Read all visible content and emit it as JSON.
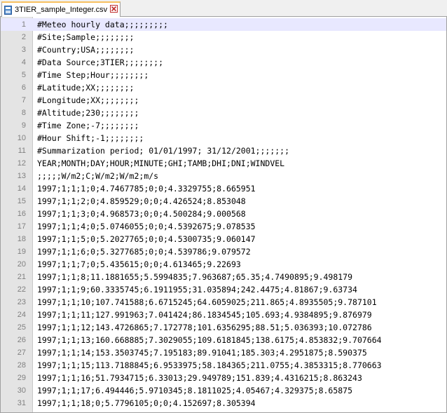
{
  "tab": {
    "label": "3TIER_sample_Integer.csv",
    "icon": "file-icon",
    "close_icon": "close-icon",
    "accent": "#f7c060"
  },
  "lines": [
    {
      "n": "1",
      "text": "#Meteo hourly data;;;;;;;;;"
    },
    {
      "n": "2",
      "text": "#Site;Sample;;;;;;;;"
    },
    {
      "n": "3",
      "text": "#Country;USA;;;;;;;;"
    },
    {
      "n": "4",
      "text": "#Data Source;3TIER;;;;;;;;"
    },
    {
      "n": "5",
      "text": "#Time Step;Hour;;;;;;;;"
    },
    {
      "n": "6",
      "text": "#Latitude;XX;;;;;;;;"
    },
    {
      "n": "7",
      "text": "#Longitude;XX;;;;;;;;"
    },
    {
      "n": "8",
      "text": "#Altitude;230;;;;;;;;"
    },
    {
      "n": "9",
      "text": "#Time Zone;-7;;;;;;;;"
    },
    {
      "n": "10",
      "text": "#Hour Shift;-1;;;;;;;;"
    },
    {
      "n": "11",
      "text": "#Summarization period; 01/01/1997; 31/12/2001;;;;;;;"
    },
    {
      "n": "12",
      "text": "YEAR;MONTH;DAY;HOUR;MINUTE;GHI;TAMB;DHI;DNI;WINDVEL"
    },
    {
      "n": "13",
      "text": ";;;;;W/m2;C;W/m2;W/m2;m/s"
    },
    {
      "n": "14",
      "text": "1997;1;1;1;0;4.7467785;0;0;4.3329755;8.665951"
    },
    {
      "n": "15",
      "text": "1997;1;1;2;0;4.859529;0;0;4.426524;8.853048"
    },
    {
      "n": "16",
      "text": "1997;1;1;3;0;4.968573;0;0;4.500284;9.000568"
    },
    {
      "n": "17",
      "text": "1997;1;1;4;0;5.0746055;0;0;4.5392675;9.078535"
    },
    {
      "n": "18",
      "text": "1997;1;1;5;0;5.2027765;0;0;4.5300735;9.060147"
    },
    {
      "n": "19",
      "text": "1997;1;1;6;0;5.3277685;0;0;4.539786;9.079572"
    },
    {
      "n": "20",
      "text": "1997;1;1;7;0;5.435615;0;0;4.613465;9.22693"
    },
    {
      "n": "21",
      "text": "1997;1;1;8;11.1881655;5.5994835;7.963687;65.35;4.7490895;9.498179"
    },
    {
      "n": "22",
      "text": "1997;1;1;9;60.3335745;6.1911955;31.035894;242.4475;4.81867;9.63734"
    },
    {
      "n": "23",
      "text": "1997;1;1;10;107.741588;6.6715245;64.6059025;211.865;4.8935505;9.787101"
    },
    {
      "n": "24",
      "text": "1997;1;1;11;127.991963;7.041424;86.1834545;105.693;4.9384895;9.876979"
    },
    {
      "n": "25",
      "text": "1997;1;1;12;143.4726865;7.172778;101.6356295;88.51;5.036393;10.072786"
    },
    {
      "n": "26",
      "text": "1997;1;1;13;160.668885;7.3029055;109.6181845;138.6175;4.853832;9.707664"
    },
    {
      "n": "27",
      "text": "1997;1;1;14;153.3503745;7.195183;89.91041;185.303;4.2951875;8.590375"
    },
    {
      "n": "28",
      "text": "1997;1;1;15;113.7188845;6.9533975;58.184365;211.0755;4.3853315;8.770663"
    },
    {
      "n": "29",
      "text": "1997;1;1;16;51.7934715;6.33013;29.949789;151.839;4.4316215;8.863243"
    },
    {
      "n": "30",
      "text": "1997;1;1;17;6.494446;5.9710345;8.1811025;4.05467;4.329375;8.65875"
    },
    {
      "n": "31",
      "text": "1997;1;1;18;0;5.7796105;0;0;4.152697;8.305394"
    }
  ],
  "current_line": 1,
  "colors": {
    "gutter_bg": "#e4e4e4",
    "line_number": "#808080",
    "current_line_bg": "#e8e8ff"
  }
}
